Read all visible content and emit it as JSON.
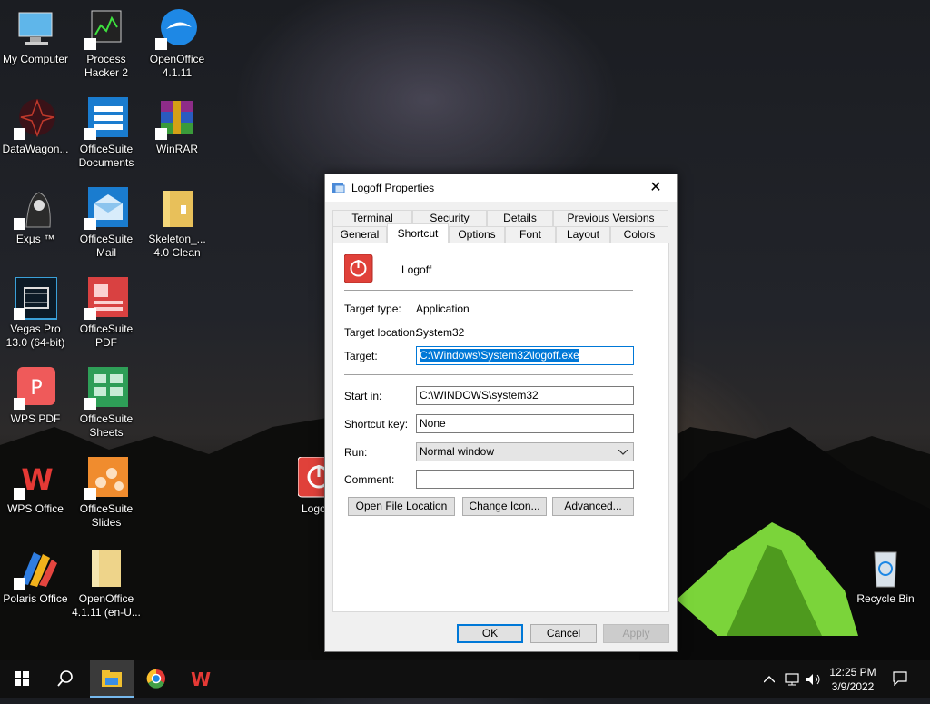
{
  "desktop": {
    "icons": [
      {
        "label": "My Computer",
        "icon": "monitor-icon"
      },
      {
        "label": "Process Hacker 2",
        "icon": "process-hacker-icon"
      },
      {
        "label": "OpenOffice 4.1.11",
        "icon": "openoffice-icon"
      },
      {
        "label": "DataWagon...",
        "icon": "datawagon-icon"
      },
      {
        "label": "OfficeSuite Documents",
        "icon": "officesuite-documents-icon"
      },
      {
        "label": "WinRAR",
        "icon": "winrar-icon"
      },
      {
        "label": "Exµs ™",
        "icon": "exus-icon"
      },
      {
        "label": "OfficeSuite Mail",
        "icon": "officesuite-mail-icon"
      },
      {
        "label": "Skeleton_... 4.0 Clean",
        "icon": "folder-icon"
      },
      {
        "label": "Vegas Pro 13.0 (64-bit)",
        "icon": "vegas-pro-icon"
      },
      {
        "label": "OfficeSuite PDF",
        "icon": "officesuite-pdf-icon"
      },
      {
        "label": "WPS PDF",
        "icon": "wps-pdf-icon"
      },
      {
        "label": "OfficeSuite Sheets",
        "icon": "officesuite-sheets-icon"
      },
      {
        "label": "WPS Office",
        "icon": "wps-office-icon"
      },
      {
        "label": "OfficeSuite Slides",
        "icon": "officesuite-slides-icon"
      },
      {
        "label": "Polaris Office",
        "icon": "polaris-office-icon"
      },
      {
        "label": "OpenOffice 4.1.11 (en-U...",
        "icon": "folder-icon"
      },
      {
        "label": "Logo",
        "icon": "logoff-icon"
      },
      {
        "label": "Recycle Bin",
        "icon": "recycle-bin-icon"
      }
    ]
  },
  "dialog": {
    "title": "Logoff Properties",
    "close_glyph": "✕",
    "tabs_top": [
      "Terminal",
      "Security",
      "Details",
      "Previous Versions"
    ],
    "tabs_bottom": [
      "General",
      "Shortcut",
      "Options",
      "Font",
      "Layout",
      "Colors"
    ],
    "active_tab": "Shortcut",
    "shortcut_name": "Logoff",
    "target_type_label": "Target type:",
    "target_type_value": "Application",
    "target_location_label": "Target location:",
    "target_location_value": "System32",
    "target_label": "Target:",
    "target_value": "C:\\Windows\\System32\\logoff.exe",
    "start_in_label": "Start in:",
    "start_in_value": "C:\\WINDOWS\\system32",
    "shortcut_key_label": "Shortcut key:",
    "shortcut_key_value": "None",
    "run_label": "Run:",
    "run_value": "Normal window",
    "comment_label": "Comment:",
    "comment_value": "",
    "open_file_location": "Open File Location",
    "change_icon": "Change Icon...",
    "advanced": "Advanced...",
    "ok": "OK",
    "cancel": "Cancel",
    "apply": "Apply"
  },
  "taskbar": {
    "time": "12:25 PM",
    "date": "3/9/2022",
    "items": [
      "windows-start-icon",
      "search-icon",
      "file-explorer-icon",
      "chrome-icon",
      "wps-office-icon"
    ]
  },
  "colors": {
    "accent": "#0078d7",
    "logoff_red": "#e0413a",
    "taskbar": "#101010"
  }
}
